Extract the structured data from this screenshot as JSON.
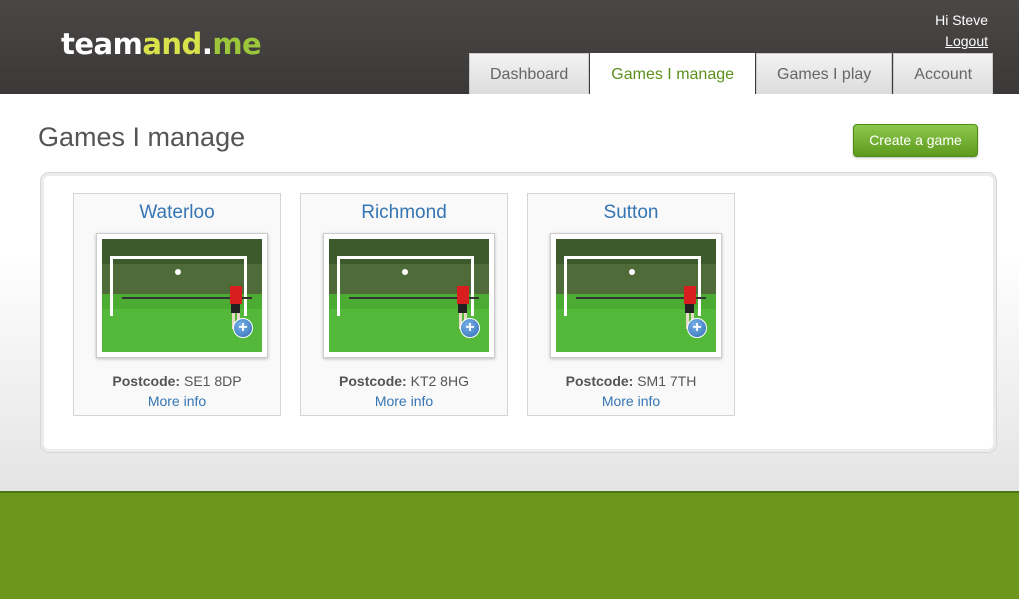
{
  "logo": {
    "part1": "team",
    "part2": "and",
    "part3": ".",
    "part4": "me"
  },
  "user": {
    "greeting": "Hi Steve",
    "logout": "Logout"
  },
  "tabs": [
    {
      "label": "Dashboard"
    },
    {
      "label": "Games I manage"
    },
    {
      "label": "Games I play"
    },
    {
      "label": "Account"
    }
  ],
  "page": {
    "title": "Games I manage",
    "create_button": "Create a game"
  },
  "games": [
    {
      "name": "Waterloo",
      "postcode_label": "Postcode:",
      "postcode": "SE1 8DP",
      "more": "More info"
    },
    {
      "name": "Richmond",
      "postcode_label": "Postcode:",
      "postcode": "KT2 8HG",
      "more": "More info"
    },
    {
      "name": "Sutton",
      "postcode_label": "Postcode:",
      "postcode": "SM1 7TH",
      "more": "More info"
    }
  ],
  "colors": {
    "accent_green": "#6c961c",
    "link_blue": "#3575b3",
    "header_dark": "#3b3938"
  }
}
